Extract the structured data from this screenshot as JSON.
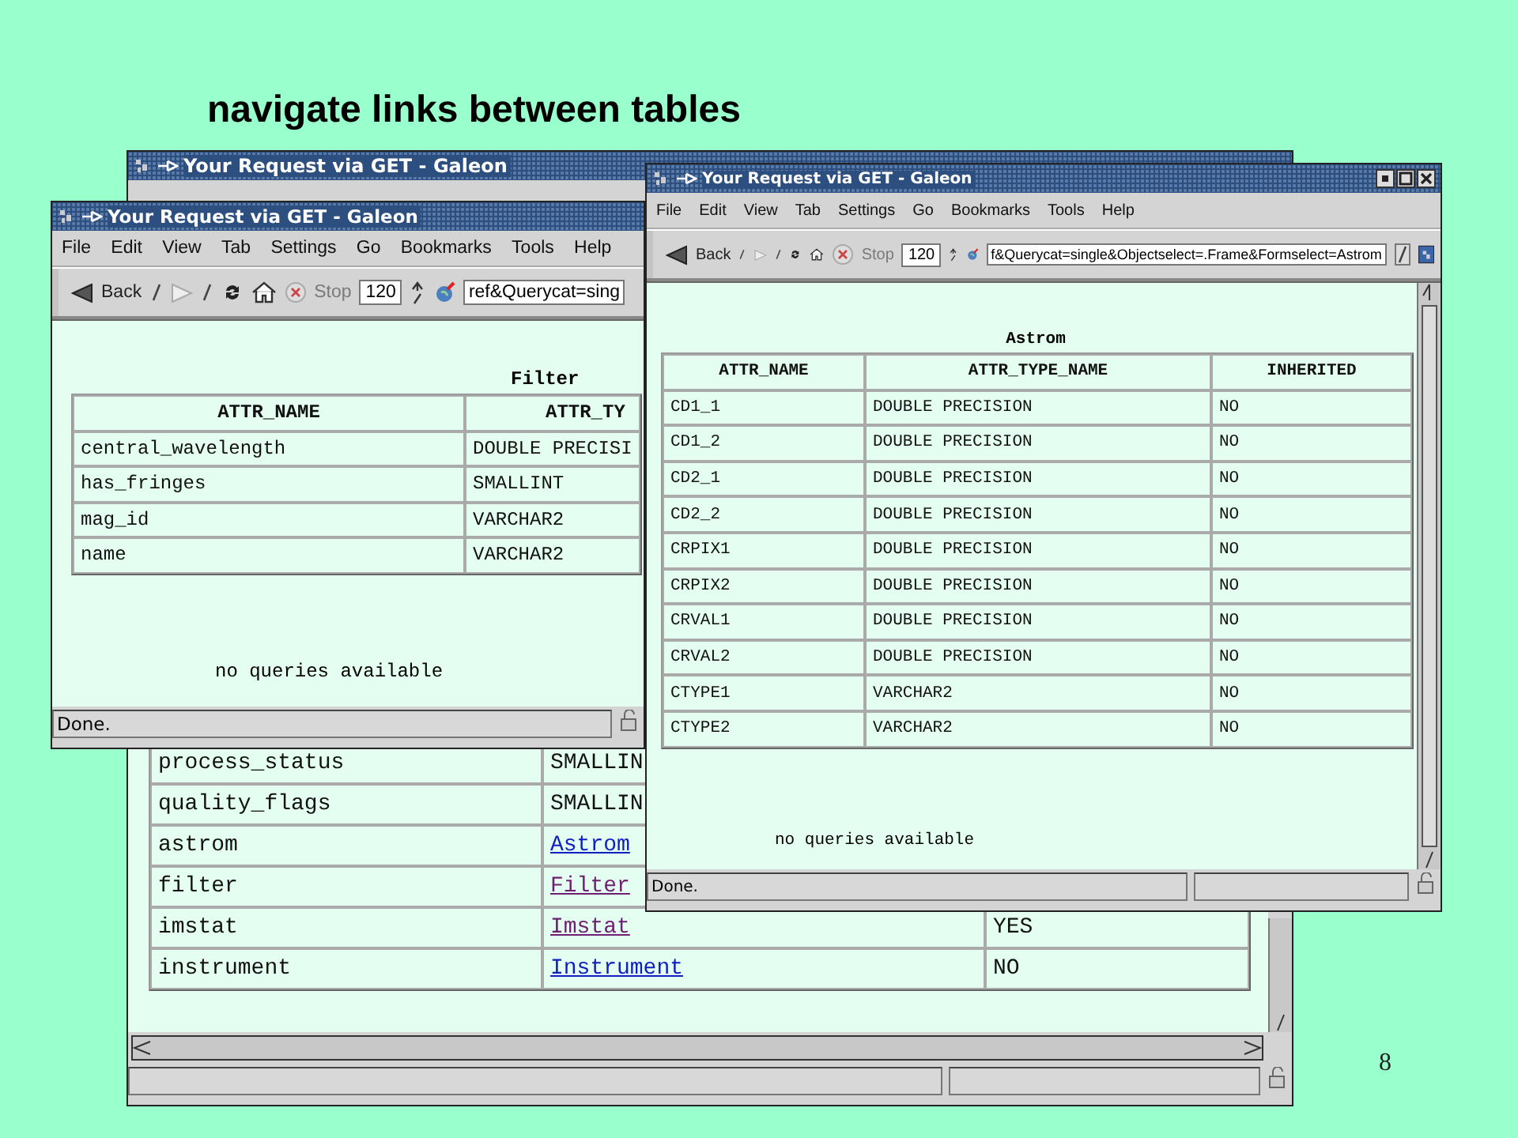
{
  "slide_title": "navigate links between tables",
  "windows": [
    {
      "title": "Your Request via GET - Galeon",
      "table": {
        "rows": [
          [
            "process_status",
            "SMALLIN"
          ],
          [
            "quality_flags",
            "SMALLIN"
          ],
          [
            "astrom",
            {
              "text": "Astrom",
              "visited": false
            }
          ],
          [
            "filter",
            {
              "text": "Filter",
              "visited": true
            }
          ],
          [
            "imstat",
            {
              "text": "Imstat",
              "visited": true
            },
            "YES"
          ],
          [
            "instrument",
            {
              "text": "Instrument",
              "visited": false
            },
            "NO"
          ]
        ]
      }
    },
    {
      "title": "Your Request via GET - Galeon",
      "menu": [
        "File",
        "Edit",
        "View",
        "Tab",
        "Settings",
        "Go",
        "Bookmarks",
        "Tools",
        "Help"
      ],
      "toolbar": [
        {
          "kind": "back",
          "label": "Back",
          "disabled": false
        },
        {
          "kind": "forward",
          "disabled": true
        },
        {
          "kind": "reload"
        },
        {
          "kind": "home"
        },
        {
          "kind": "stop",
          "label": "Stop",
          "disabled": true
        },
        {
          "kind": "zoom",
          "value": "120"
        },
        {
          "kind": "url",
          "value": "ref&Querycat=sing"
        }
      ],
      "heading": "Filter",
      "table": {
        "columns": [
          "ATTR_NAME",
          "ATTR_TY"
        ],
        "rows": [
          [
            "central_wavelength",
            "DOUBLE PRECISI"
          ],
          [
            "has_fringes",
            "SMALLINT"
          ],
          [
            "mag_id",
            "VARCHAR2"
          ],
          [
            "name",
            "VARCHAR2"
          ]
        ]
      },
      "note": "no queries available",
      "status": "Done."
    },
    {
      "title": "Your Request via GET - Galeon",
      "menu": [
        "File",
        "Edit",
        "View",
        "Tab",
        "Settings",
        "Go",
        "Bookmarks",
        "Tools",
        "Help"
      ],
      "toolbar": [
        {
          "kind": "back",
          "label": "Back",
          "disabled": false
        },
        {
          "kind": "forward",
          "disabled": true
        },
        {
          "kind": "reload"
        },
        {
          "kind": "home"
        },
        {
          "kind": "stop",
          "label": "Stop",
          "disabled": true
        },
        {
          "kind": "zoom",
          "value": "120"
        },
        {
          "kind": "url",
          "value": "f&Querycat=single&Objectselect=.Frame&Formselect=Astrom"
        }
      ],
      "heading": "Astrom",
      "table": {
        "columns": [
          "ATTR_NAME",
          "ATTR_TYPE_NAME",
          "INHERITED"
        ],
        "rows": [
          [
            "CD1_1",
            "DOUBLE PRECISION",
            "NO"
          ],
          [
            "CD1_2",
            "DOUBLE PRECISION",
            "NO"
          ],
          [
            "CD2_1",
            "DOUBLE PRECISION",
            "NO"
          ],
          [
            "CD2_2",
            "DOUBLE PRECISION",
            "NO"
          ],
          [
            "CRPIX1",
            "DOUBLE PRECISION",
            "NO"
          ],
          [
            "CRPIX2",
            "DOUBLE PRECISION",
            "NO"
          ],
          [
            "CRVAL1",
            "DOUBLE PRECISION",
            "NO"
          ],
          [
            "CRVAL2",
            "DOUBLE PRECISION",
            "NO"
          ],
          [
            "CTYPE1",
            "VARCHAR2",
            "NO"
          ],
          [
            "CTYPE2",
            "VARCHAR2",
            "NO"
          ]
        ]
      },
      "note": "no queries available",
      "status": "Done."
    }
  ],
  "page_number": "8"
}
